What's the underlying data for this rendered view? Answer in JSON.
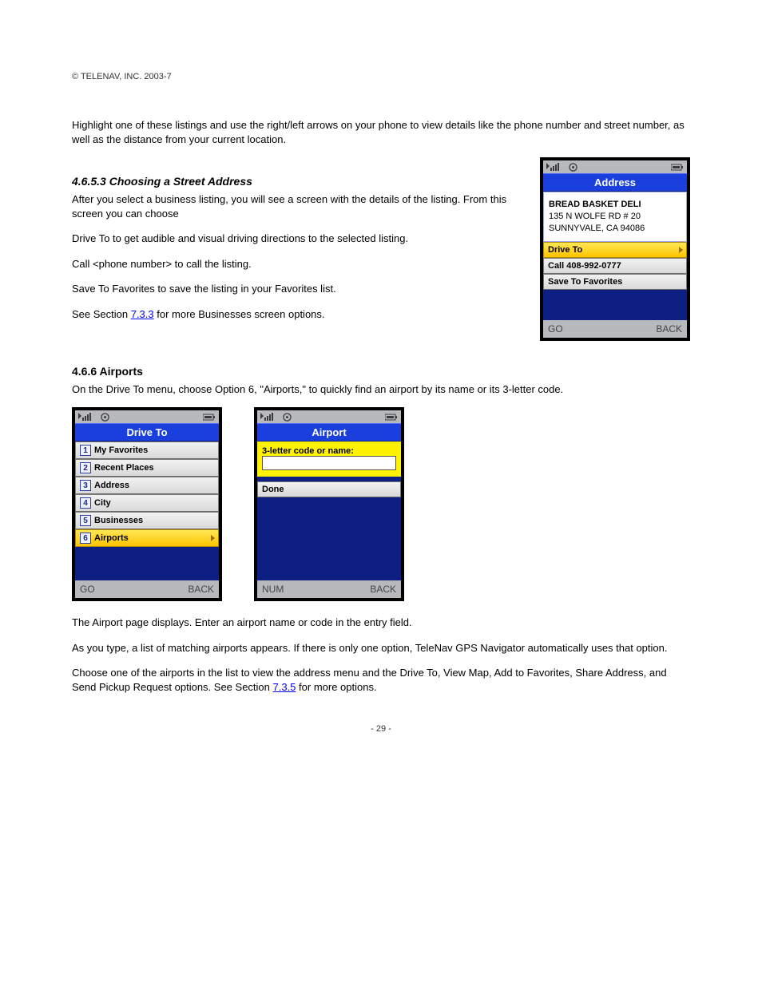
{
  "copyright": "© TELENAV, INC. 2003-7",
  "page_number": "- 29 -",
  "section1": {
    "paras": [
      "Highlight one of these listings and use the right/left arrows on your phone to view details like the phone number and street number, as well as the distance from your current location."
    ]
  },
  "section2": {
    "heading": "4.6.5.3 Choosing a Street Address",
    "para_before": "After you select a business listing, you will see a screen with the details of the listing. From this screen you can choose",
    "bullets": [
      "Drive To to get audible and visual driving directions to the selected listing.",
      "Call <phone number> to call the listing.",
      "Save To Favorites to save the listing in your Favorites list."
    ],
    "para_after": "See Section 7.3.3 for more Businesses screen options."
  },
  "section3": {
    "heading": "4.6.6 Airports",
    "para": "On the Drive To menu, choose Option 6, \"Airports,\" to quickly find an airport by its name or its 3-letter code."
  },
  "section4": {
    "para1": "The Airport page displays. Enter an airport name or code in the entry field.",
    "para2": "As you type, a list of matching airports appears. If there is only one option, TeleNav GPS Navigator automatically uses that option.",
    "para3": "Choose one of the airports in the list to view the address menu and the Drive To, View Map, Add to Favorites, Share Address, and Send Pickup Request options. See Section 7.3.5 for more options."
  },
  "phone_address": {
    "title": "Address",
    "name": "BREAD BASKET DELI",
    "line1": "135 N WOLFE RD # 20",
    "line2": "SUNNYVALE, CA 94086",
    "actions": [
      {
        "label": "Drive To",
        "selected": true
      },
      {
        "label": "Call 408-992-0777",
        "selected": false
      },
      {
        "label": "Save To Favorites",
        "selected": false
      }
    ],
    "soft_left": "GO",
    "soft_right": "BACK"
  },
  "phone_driveto": {
    "title": "Drive To",
    "items": [
      {
        "num": "1",
        "label": "My Favorites",
        "selected": false
      },
      {
        "num": "2",
        "label": "Recent Places",
        "selected": false
      },
      {
        "num": "3",
        "label": "Address",
        "selected": false
      },
      {
        "num": "4",
        "label": "City",
        "selected": false
      },
      {
        "num": "5",
        "label": "Businesses",
        "selected": false
      },
      {
        "num": "6",
        "label": "Airports",
        "selected": true
      }
    ],
    "soft_left": "GO",
    "soft_right": "BACK"
  },
  "phone_airport": {
    "title": "Airport",
    "prompt": "3-letter code or name:",
    "input_value": "",
    "done_label": "Done",
    "soft_left": "NUM",
    "soft_right": "BACK"
  }
}
